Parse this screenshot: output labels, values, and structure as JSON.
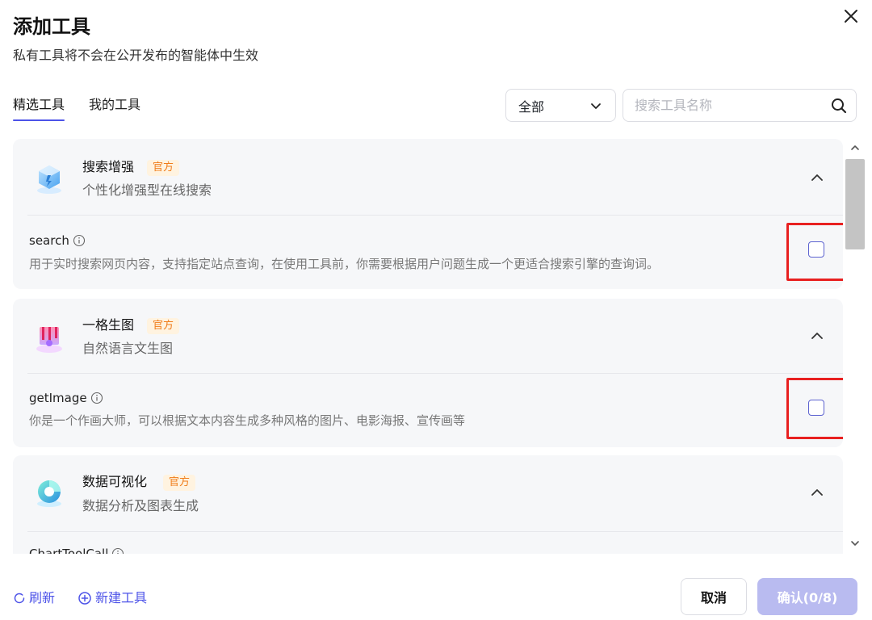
{
  "dialog": {
    "title": "添加工具",
    "subtitle": "私有工具将不会在公开发布的智能体中生效"
  },
  "tabs": [
    {
      "label": "精选工具",
      "active": true
    },
    {
      "label": "我的工具",
      "active": false
    }
  ],
  "filter": {
    "selected": "全部"
  },
  "search": {
    "placeholder": "搜索工具名称"
  },
  "plugins": [
    {
      "name": "搜索增强",
      "badge": "官方",
      "description": "个性化增强型在线搜索",
      "icon": "search-enhance-logo",
      "tool": {
        "name": "search",
        "description": "用于实时搜索网页内容，支持指定站点查询，在使用工具前，你需要根据用户问题生成一个更适合搜索引擎的查询词。",
        "checked": false
      }
    },
    {
      "name": "一格生图",
      "badge": "官方",
      "description": "自然语言文生图",
      "icon": "image-gen-logo",
      "tool": {
        "name": "getImage",
        "description": "你是一个作画大师，可以根据文本内容生成多种风格的图片、电影海报、宣传画等",
        "checked": false
      }
    },
    {
      "name": "数据可视化",
      "badge": "官方",
      "description": "数据分析及图表生成",
      "icon": "data-viz-logo",
      "tool": {
        "name": "ChartToolCall",
        "description": "",
        "checked": false
      }
    }
  ],
  "footer": {
    "refresh_label": "刷新",
    "new_tool_label": "新建工具",
    "cancel_label": "取消",
    "confirm_label": "确认(0/8)"
  },
  "colors": {
    "accent": "#4d53e8",
    "confirm_disabled": "#b9bbf0",
    "badge_text": "#f07d1a",
    "badge_bg": "#fff3e0",
    "card_bg": "#f6f7f9",
    "highlight": "#e82020"
  }
}
